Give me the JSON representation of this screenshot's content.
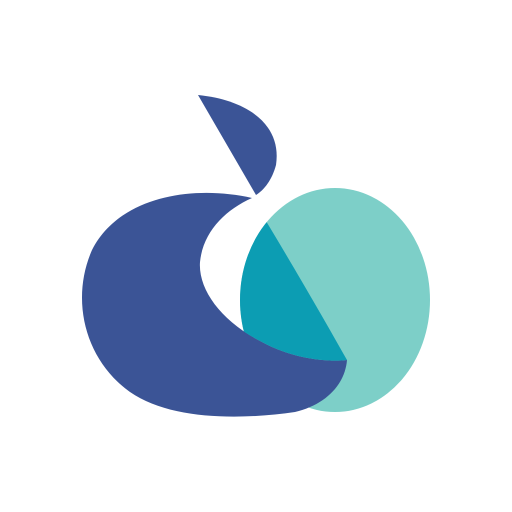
{
  "logo": {
    "name": "apple-logo",
    "colors": {
      "background": "#ffffff",
      "navy": "#3b5496",
      "teal": "#0c9db3",
      "mint": "#7dcfc8"
    }
  }
}
